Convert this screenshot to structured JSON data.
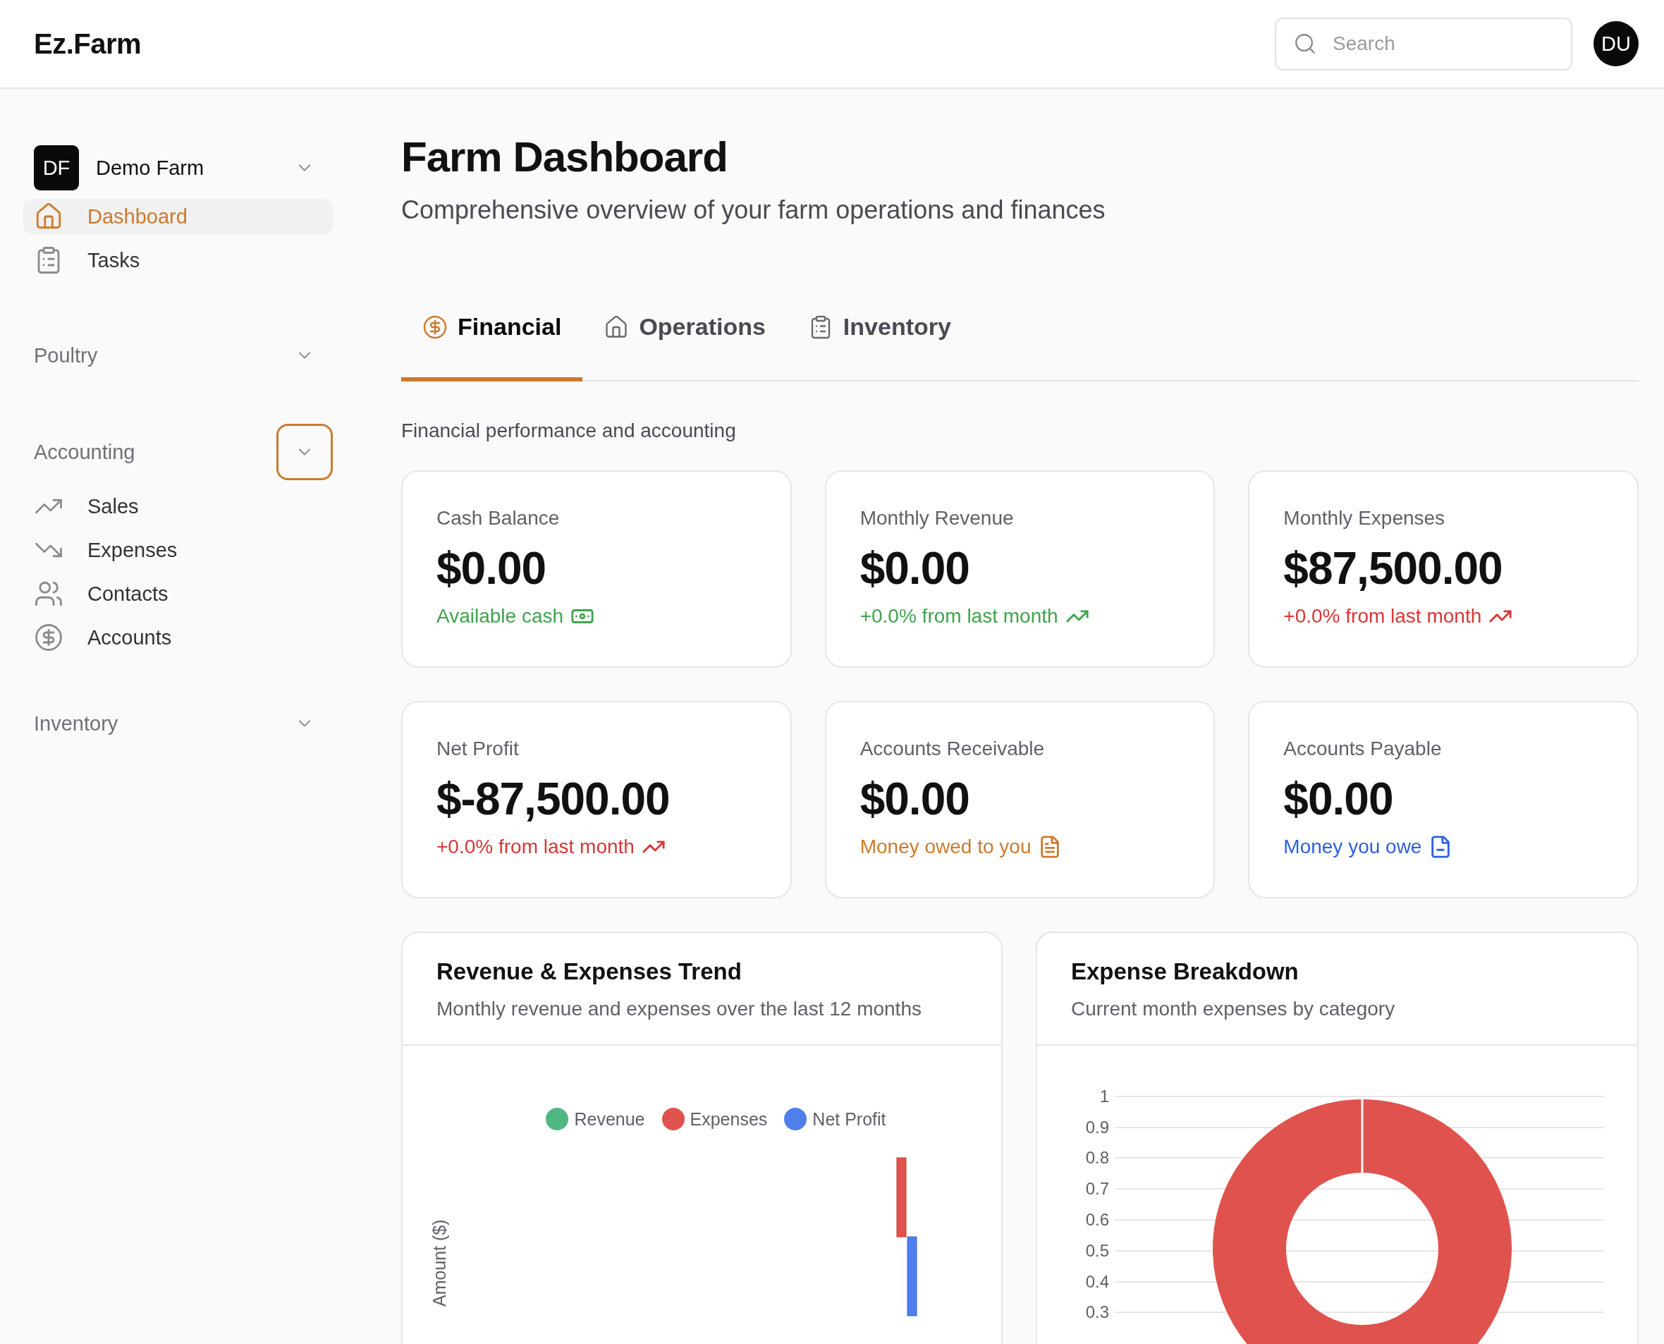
{
  "header": {
    "logo": "Ez.Farm",
    "search": {
      "placeholder": "Search"
    },
    "avatar": "DU"
  },
  "sidebar": {
    "farm": {
      "initials": "DF",
      "name": "Demo Farm"
    },
    "items": [
      {
        "label": "Dashboard",
        "selected": true
      },
      {
        "label": "Tasks",
        "selected": false
      }
    ],
    "sections": [
      {
        "label": "Poultry",
        "focused": false
      },
      {
        "label": "Accounting",
        "focused": true,
        "items": [
          {
            "label": "Sales"
          },
          {
            "label": "Expenses"
          },
          {
            "label": "Contacts"
          },
          {
            "label": "Accounts"
          }
        ]
      },
      {
        "label": "Inventory",
        "focused": false
      }
    ]
  },
  "page": {
    "title": "Farm Dashboard",
    "subtitle": "Comprehensive overview of your farm operations and finances"
  },
  "tabs": [
    {
      "label": "Financial",
      "selected": true
    },
    {
      "label": "Operations",
      "selected": false
    },
    {
      "label": "Inventory",
      "selected": false
    }
  ],
  "section_description": "Financial performance and accounting",
  "cards": [
    {
      "label": "Cash Balance",
      "value": "$0.00",
      "note": "Available cash",
      "color": "#3fa34d"
    },
    {
      "label": "Monthly Revenue",
      "value": "$0.00",
      "note": "+0.0% from last month",
      "color": "#3fa34d"
    },
    {
      "label": "Monthly Expenses",
      "value": "$87,500.00",
      "note": "+0.0% from last month",
      "color": "#d93636"
    },
    {
      "label": "Net Profit",
      "value": "$-87,500.00",
      "note": "+0.0% from last month",
      "color": "#d93636"
    },
    {
      "label": "Accounts Receivable",
      "value": "$0.00",
      "note": "Money owed to you",
      "color": "#cd7a2c"
    },
    {
      "label": "Accounts Payable",
      "value": "$0.00",
      "note": "Money you owe",
      "color": "#2f5fe0"
    }
  ],
  "trend_chart": {
    "title": "Revenue & Expenses Trend",
    "subtitle": "Monthly revenue and expenses over the last 12 months",
    "y_axis_title": "Amount ($)",
    "legend": [
      {
        "label": "Revenue",
        "color": "#4fb882"
      },
      {
        "label": "Expenses",
        "color": "#e0524d"
      },
      {
        "label": "Net Profit",
        "color": "#4f7fea"
      }
    ]
  },
  "breakdown_chart": {
    "title": "Expense Breakdown",
    "subtitle": "Current month expenses by category",
    "axis_labels": [
      "1",
      "0.9",
      "0.8",
      "0.7",
      "0.6",
      "0.5",
      "0.4",
      "0.3"
    ]
  }
}
